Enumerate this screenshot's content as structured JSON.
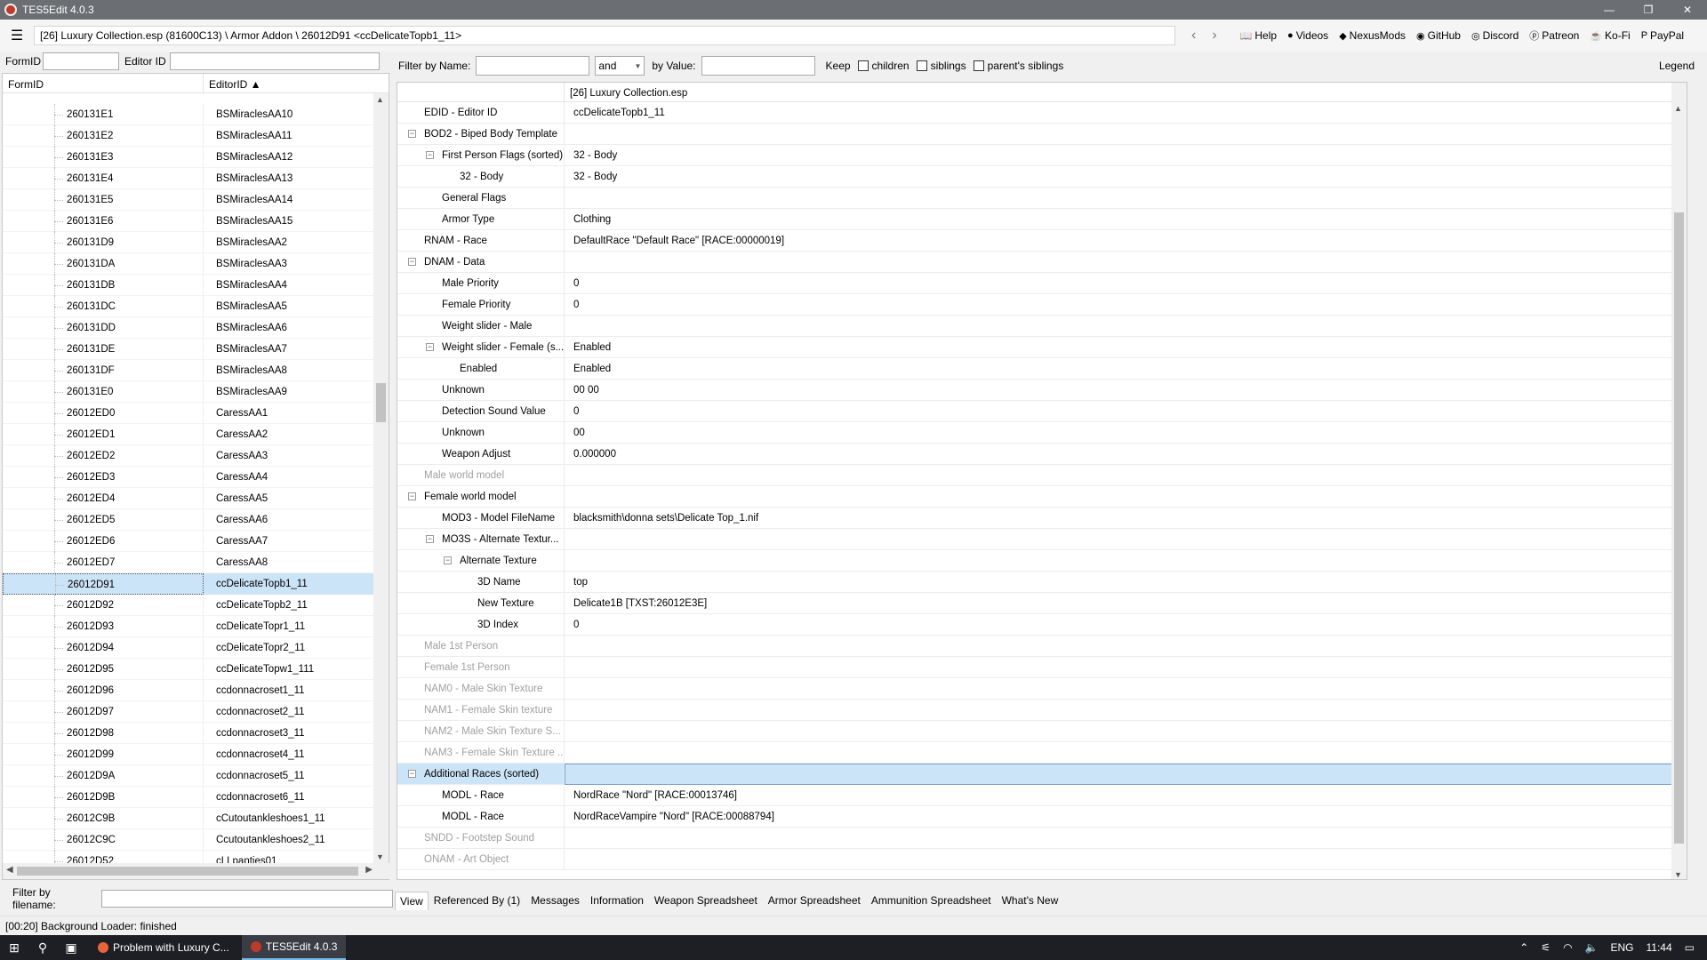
{
  "window": {
    "title": "TES5Edit 4.0.3",
    "controls": [
      "—",
      "❐",
      "✕"
    ]
  },
  "path": {
    "text": "[26] Luxury Collection.esp (81600C13) \\ Armor Addon \\ 26012D91 <ccDelicateTopb1_11>"
  },
  "nav": {
    "back": "‹",
    "forward": "›"
  },
  "toplinks": [
    {
      "label": "Help",
      "icon": "📖"
    },
    {
      "label": "Videos",
      "icon": "●"
    },
    {
      "label": "NexusMods",
      "icon": "◆"
    },
    {
      "label": "GitHub",
      "icon": "◉"
    },
    {
      "label": "Discord",
      "icon": "◎"
    },
    {
      "label": "Patreon",
      "icon": "ⓟ"
    },
    {
      "label": "Ko-Fi",
      "icon": "☕"
    },
    {
      "label": "PayPal",
      "icon": "P"
    }
  ],
  "left": {
    "formid_label": "FormID",
    "editorid_label": "Editor ID",
    "col_formid": "FormID",
    "col_editorid": "EditorID ▲",
    "filter_filename_label": "Filter by filename:",
    "rows": [
      {
        "fid": "260131E1",
        "eid": "BSMiraclesAA10"
      },
      {
        "fid": "260131E2",
        "eid": "BSMiraclesAA11"
      },
      {
        "fid": "260131E3",
        "eid": "BSMiraclesAA12"
      },
      {
        "fid": "260131E4",
        "eid": "BSMiraclesAA13"
      },
      {
        "fid": "260131E5",
        "eid": "BSMiraclesAA14"
      },
      {
        "fid": "260131E6",
        "eid": "BSMiraclesAA15"
      },
      {
        "fid": "260131D9",
        "eid": "BSMiraclesAA2"
      },
      {
        "fid": "260131DA",
        "eid": "BSMiraclesAA3"
      },
      {
        "fid": "260131DB",
        "eid": "BSMiraclesAA4"
      },
      {
        "fid": "260131DC",
        "eid": "BSMiraclesAA5"
      },
      {
        "fid": "260131DD",
        "eid": "BSMiraclesAA6"
      },
      {
        "fid": "260131DE",
        "eid": "BSMiraclesAA7"
      },
      {
        "fid": "260131DF",
        "eid": "BSMiraclesAA8"
      },
      {
        "fid": "260131E0",
        "eid": "BSMiraclesAA9"
      },
      {
        "fid": "26012ED0",
        "eid": "CaressAA1"
      },
      {
        "fid": "26012ED1",
        "eid": "CaressAA2"
      },
      {
        "fid": "26012ED2",
        "eid": "CaressAA3"
      },
      {
        "fid": "26012ED3",
        "eid": "CaressAA4"
      },
      {
        "fid": "26012ED4",
        "eid": "CaressAA5"
      },
      {
        "fid": "26012ED5",
        "eid": "CaressAA6"
      },
      {
        "fid": "26012ED6",
        "eid": "CaressAA7"
      },
      {
        "fid": "26012ED7",
        "eid": "CaressAA8"
      },
      {
        "fid": "26012D91",
        "eid": "ccDelicateTopb1_11",
        "selected": true
      },
      {
        "fid": "26012D92",
        "eid": "ccDelicateTopb2_11"
      },
      {
        "fid": "26012D93",
        "eid": "ccDelicateTopr1_11"
      },
      {
        "fid": "26012D94",
        "eid": "ccDelicateTopr2_11"
      },
      {
        "fid": "26012D95",
        "eid": "ccDelicateTopw1_111"
      },
      {
        "fid": "26012D96",
        "eid": "ccdonnacroset1_11"
      },
      {
        "fid": "26012D97",
        "eid": "ccdonnacroset2_11"
      },
      {
        "fid": "26012D98",
        "eid": "ccdonnacroset3_11"
      },
      {
        "fid": "26012D99",
        "eid": "ccdonnacroset4_11"
      },
      {
        "fid": "26012D9A",
        "eid": "ccdonnacroset5_11"
      },
      {
        "fid": "26012D9B",
        "eid": "ccdonnacroset6_11"
      },
      {
        "fid": "26012C9B",
        "eid": "cCutoutankleshoes1_11"
      },
      {
        "fid": "26012C9C",
        "eid": "Ccutoutankleshoes2_11"
      },
      {
        "fid": "26012D52",
        "eid": "cLLpanties01"
      }
    ]
  },
  "filter": {
    "by_name_label": "Filter by Name:",
    "and_value": "and",
    "by_value_label": "by Value:",
    "keep_label": "Keep",
    "children": "children",
    "siblings": "siblings",
    "parents_siblings": "parent's siblings",
    "legend": "Legend"
  },
  "grid": {
    "file_header": "[26] Luxury Collection.esp",
    "rows": [
      {
        "label": "EDID - Editor ID",
        "value": "ccDelicateTopb1_11",
        "level": 0
      },
      {
        "label": "BOD2 - Biped Body Template",
        "value": "",
        "level": 0,
        "toggle": "−"
      },
      {
        "label": "First Person Flags (sorted)",
        "value": "32 - Body",
        "level": 1,
        "toggle": "−"
      },
      {
        "label": "32 - Body",
        "value": "32 - Body",
        "level": 2
      },
      {
        "label": "General Flags",
        "value": "",
        "level": 1
      },
      {
        "label": "Armor Type",
        "value": "Clothing",
        "level": 1
      },
      {
        "label": "RNAM - Race",
        "value": "DefaultRace \"Default Race\" [RACE:00000019]",
        "level": 0
      },
      {
        "label": "DNAM - Data",
        "value": "",
        "level": 0,
        "toggle": "−"
      },
      {
        "label": "Male Priority",
        "value": "0",
        "level": 1
      },
      {
        "label": "Female Priority",
        "value": "0",
        "level": 1
      },
      {
        "label": "Weight slider - Male",
        "value": "",
        "level": 1
      },
      {
        "label": "Weight slider - Female (s...",
        "value": "Enabled",
        "level": 1,
        "toggle": "−"
      },
      {
        "label": "Enabled",
        "value": "Enabled",
        "level": 2
      },
      {
        "label": "Unknown",
        "value": "00 00",
        "level": 1
      },
      {
        "label": "Detection Sound Value",
        "value": "0",
        "level": 1
      },
      {
        "label": "Unknown",
        "value": "00",
        "level": 1
      },
      {
        "label": "Weapon Adjust",
        "value": "0.000000",
        "level": 1
      },
      {
        "label": "Male world model",
        "value": "",
        "level": 0,
        "dim": true
      },
      {
        "label": "Female world model",
        "value": "",
        "level": 0,
        "toggle": "−"
      },
      {
        "label": "MOD3 - Model FileName",
        "value": "blacksmith\\donna sets\\Delicate Top_1.nif",
        "level": 1
      },
      {
        "label": "MO3S - Alternate Textur...",
        "value": "",
        "level": 1,
        "toggle": "−"
      },
      {
        "label": "Alternate Texture",
        "value": "",
        "level": 2,
        "toggle": "−"
      },
      {
        "label": "3D Name",
        "value": "top",
        "level": 3
      },
      {
        "label": "New Texture",
        "value": "Delicate1B [TXST:26012E3E]",
        "level": 3
      },
      {
        "label": "3D Index",
        "value": "0",
        "level": 3
      },
      {
        "label": "Male 1st Person",
        "value": "",
        "level": 0,
        "dim": true
      },
      {
        "label": "Female 1st Person",
        "value": "",
        "level": 0,
        "dim": true
      },
      {
        "label": "NAM0 - Male Skin Texture",
        "value": "",
        "level": 0,
        "dim": true
      },
      {
        "label": "NAM1 - Female Skin texture",
        "value": "",
        "level": 0,
        "dim": true
      },
      {
        "label": "NAM2 - Male Skin Texture S...",
        "value": "",
        "level": 0,
        "dim": true
      },
      {
        "label": "NAM3 - Female Skin Texture ...",
        "value": "",
        "level": 0,
        "dim": true
      },
      {
        "label": "Additional Races (sorted)",
        "value": "",
        "level": 0,
        "toggle": "−",
        "highlight": true
      },
      {
        "label": "MODL - Race",
        "value": "NordRace \"Nord\" [RACE:00013746]",
        "level": 1
      },
      {
        "label": "MODL - Race",
        "value": "NordRaceVampire \"Nord\" [RACE:00088794]",
        "level": 1
      },
      {
        "label": "SNDD - Footstep Sound",
        "value": "",
        "level": 0,
        "dim": true
      },
      {
        "label": "ONAM - Art Object",
        "value": "",
        "level": 0,
        "dim": true
      }
    ]
  },
  "tabs": [
    "View",
    "Referenced By (1)",
    "Messages",
    "Information",
    "Weapon Spreadsheet",
    "Armor Spreadsheet",
    "Ammunition Spreadsheet",
    "What's New"
  ],
  "status": {
    "text": "[00:20] Background Loader: finished"
  },
  "taskbar": {
    "apps": [
      {
        "label": "Problem with Luxury C...",
        "color": "#e8643a"
      },
      {
        "label": "TES5Edit 4.0.3",
        "color": "#c0392b",
        "active": true
      }
    ],
    "lang": "ENG",
    "time": "11:44"
  },
  "colors": {
    "selection": "#cce4f7",
    "titlebar": "#6b6e73",
    "taskbar": "#1d1f24"
  }
}
